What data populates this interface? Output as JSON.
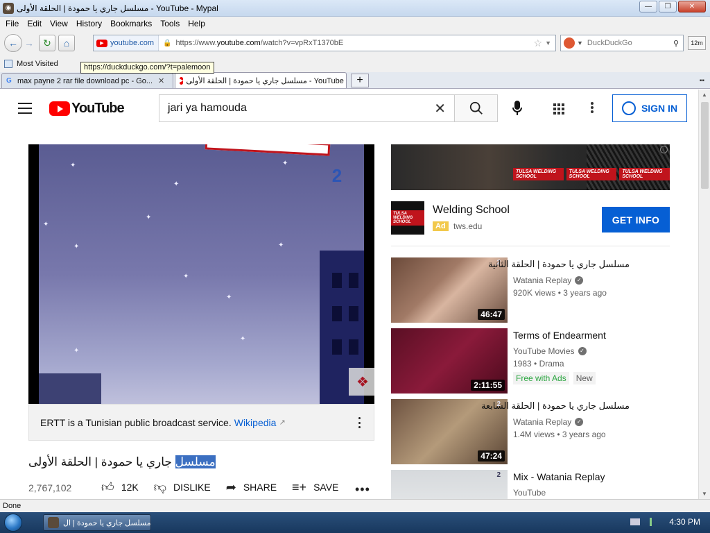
{
  "window": {
    "title": "مسلسل جاري يا حمودة | الحلقة الأولى - YouTube - Mypal",
    "buttons": {
      "minimize": "—",
      "maximize": "❐",
      "close": "✕"
    }
  },
  "menu": [
    "File",
    "Edit",
    "View",
    "History",
    "Bookmarks",
    "Tools",
    "Help"
  ],
  "nav": {
    "identity": "youtube.com",
    "url_prefix": "https://www.",
    "url_domain": "youtube.com",
    "url_rest": "/watch?v=vpRxT1370bE",
    "search_engine": "DuckDuckGo",
    "addon_label": "12m"
  },
  "bookmarks": {
    "most_visited": "Most Visited"
  },
  "tooltip": "https://duckduckgo.com/?t=palemoon",
  "tabs": [
    {
      "label": "max payne 2 rar file download pc - Go...",
      "favicon": "G"
    },
    {
      "label": "مسلسل جاري يا حمودة | الحلقة الأولى - YouTube",
      "favicon": "yt"
    }
  ],
  "youtube": {
    "logo": "YouTube",
    "search_query": "jari ya hamouda",
    "sign_in": "SIGN IN"
  },
  "video": {
    "info_text": "ERTT is a Tunisian public broadcast service.",
    "info_link": "Wikipedia",
    "title_highlight": "مسلسل",
    "title_rest": " جاري يا حمودة | الحلقة الأولى",
    "views": "2,767,102",
    "likes": "12K",
    "dislike": "DISLIKE",
    "share": "SHARE",
    "save": "SAVE",
    "channel_logo": "2",
    "watermark": "❖"
  },
  "ad": {
    "banner_logos": [
      "TULSA WELDING SCHOOL",
      "TULSA WELDING SCHOOL",
      "TULSA WELDING SCHOOL"
    ],
    "logo_text": "TULSA WELDING SCHOOL",
    "name": "Welding School",
    "badge": "Ad",
    "domain": "tws.edu",
    "cta": "GET INFO"
  },
  "recommendations": [
    {
      "title": "مسلسل جاري يا حمودة | الحلقة الثانية",
      "arabic": true,
      "channel": "Watania Replay",
      "verified": true,
      "meta": "920K views • 3 years ago",
      "duration": "46:47",
      "thumb": "t1"
    },
    {
      "title": "Terms of Endearment",
      "arabic": false,
      "channel": "YouTube Movies",
      "verified": true,
      "meta": "1983 • Drama",
      "duration": "2:11:55",
      "thumb": "t2",
      "badges": [
        "Free with Ads",
        "New"
      ]
    },
    {
      "title": "مسلسل جاري يا حمودة | الحلقة السابعة",
      "arabic": true,
      "channel": "Watania Replay",
      "verified": true,
      "meta": "1.4M views • 3 years ago",
      "duration": "47:24",
      "thumb": "t3"
    },
    {
      "title": "Mix - Watania Replay",
      "arabic": false,
      "channel": "YouTube",
      "verified": false,
      "meta": "",
      "duration": "",
      "thumb": "t4"
    }
  ],
  "status": "Done",
  "taskbar": {
    "item": "مسلسل جاري يا حمودة | ال...",
    "clock": "4:30 PM"
  }
}
